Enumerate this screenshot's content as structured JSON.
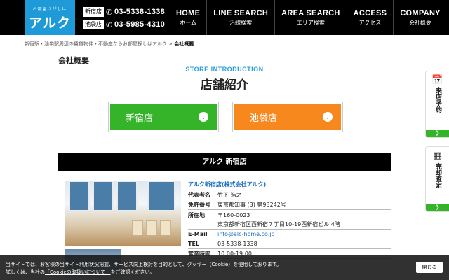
{
  "header": {
    "logo_tagline": "お部屋さがしは",
    "logo_name": "アルク",
    "phones": [
      {
        "store": "新宿店",
        "number": "03-5338-1338"
      },
      {
        "store": "池袋店",
        "number": "03-5985-4310"
      }
    ],
    "nav": [
      {
        "en": "HOME",
        "jp": "ホーム"
      },
      {
        "en": "LINE SEARCH",
        "jp": "沿線検索"
      },
      {
        "en": "AREA SEARCH",
        "jp": "エリア検索"
      },
      {
        "en": "ACCESS",
        "jp": "アクセス"
      },
      {
        "en": "COMPANY",
        "jp": "会社概要"
      }
    ]
  },
  "breadcrumb": {
    "parent": "新宿駅・池袋駅周辺の賃貸物件・不動産ならお部屋探しはアルク",
    "separator": ">",
    "current": "会社概要"
  },
  "page_title": "会社概要",
  "section": {
    "en": "STORE INTRODUCTION",
    "jp": "店舗紹介"
  },
  "store_buttons": [
    {
      "label": "新宿店",
      "color": "#35b42a"
    },
    {
      "label": "池袋店",
      "color": "#f7881d"
    }
  ],
  "store": {
    "bar_title": "アルク 新宿店",
    "company": "アルク新宿店(株式会社アルク)",
    "rows": [
      {
        "key": "代表者名",
        "value": "竹下 浩之"
      },
      {
        "key": "免許番号",
        "value": "東京都知事 (3) 第93242号"
      },
      {
        "key": "所在地",
        "value": "〒160-0023"
      },
      {
        "key": "",
        "value": "東京都新宿区西新宿７丁目10-19西新宿ビル 4階"
      },
      {
        "key": "E-Mail",
        "value": "info@alc-home.co.jp"
      },
      {
        "key": "TEL",
        "value": "03-5338-1338"
      },
      {
        "key": "営業時間",
        "value": "10:00-19:00"
      }
    ]
  },
  "side_tabs": [
    {
      "icon": "calendar-icon",
      "label": "来店予約"
    },
    {
      "icon": "calculator-icon",
      "label": "売却査定"
    }
  ],
  "cookie": {
    "line1": "当サイトでは、お客様の当サイト利用状況把握、サービス向上検討を目的として、クッキー（Cookie）を使用しております。",
    "line2_pre": "詳しくは、当社の",
    "link": "「Cookieの取扱いについて」",
    "line2_post": "をご確認ください。",
    "close": "閉じる"
  }
}
